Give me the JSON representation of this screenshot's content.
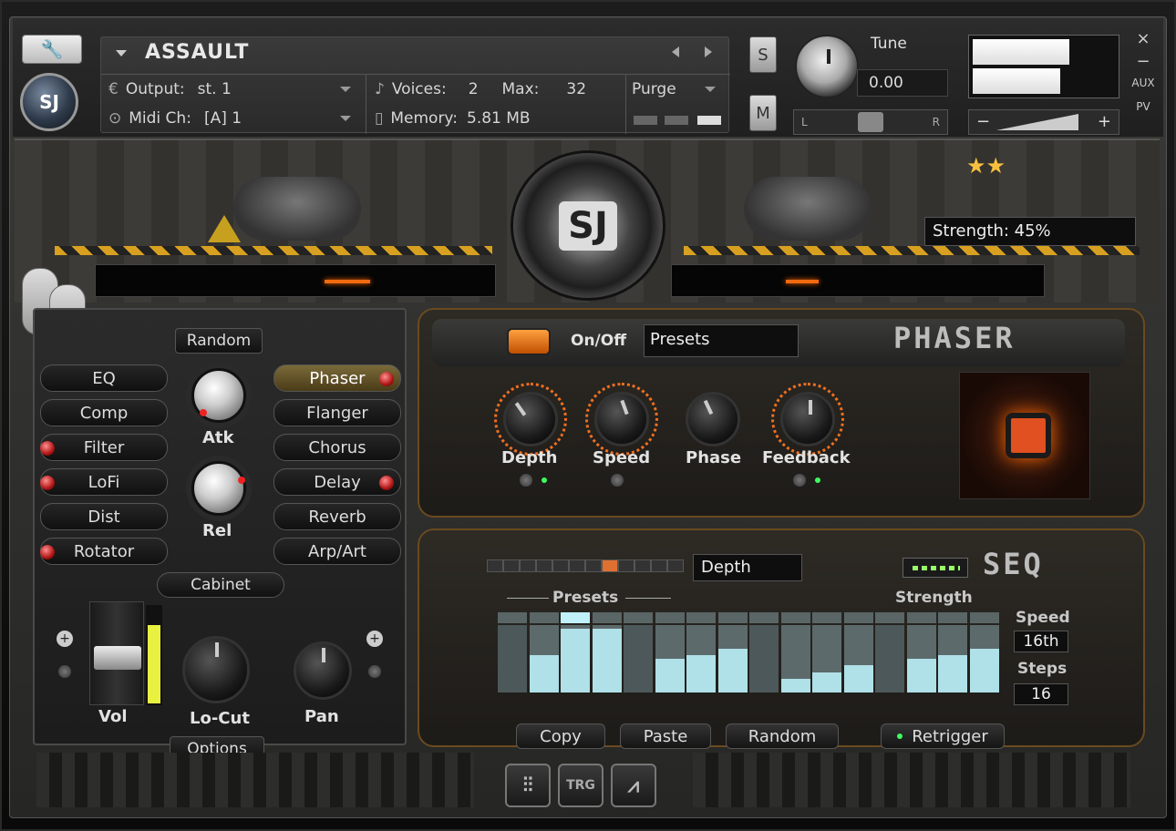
{
  "header": {
    "instrument_name": "ASSAULT",
    "output_label": "Output:",
    "output_value": "st. 1",
    "midi_label": "Midi Ch:",
    "midi_value": "[A] 1",
    "voices_label": "Voices:",
    "voices_value": "2",
    "max_label": "Max:",
    "max_value": "32",
    "memory_label": "Memory:",
    "memory_value": "5.81 MB",
    "purge_label": "Purge",
    "solo_label": "S",
    "mute_label": "M",
    "tune_label": "Tune",
    "tune_value": "0.00",
    "pan_left": "L",
    "pan_right": "R",
    "vol_minus": "−",
    "vol_plus": "+",
    "close": "×",
    "minimize": "−",
    "aux": "AUX",
    "pv": "PV"
  },
  "main": {
    "logo_text": "SJ",
    "strength_text": "Strength: 45%",
    "stars": "★★"
  },
  "left_panel": {
    "random_label": "Random",
    "fx_left": [
      "EQ",
      "Comp",
      "Filter",
      "LoFi",
      "Dist",
      "Rotator"
    ],
    "fx_right": [
      "Phaser",
      "Flanger",
      "Chorus",
      "Delay",
      "Reverb",
      "Arp/Art"
    ],
    "atk_label": "Atk",
    "rel_label": "Rel",
    "cabinet_label": "Cabinet",
    "vol_label": "Vol",
    "locut_label": "Lo-Cut",
    "pan_label": "Pan",
    "options_label": "Options"
  },
  "phaser": {
    "onoff_label": "On/Off",
    "presets_label": "Presets",
    "title": "PHASER",
    "knobs": [
      "Depth",
      "Speed",
      "Phase",
      "Feedback"
    ]
  },
  "seq": {
    "title": "SEQ",
    "target": "Depth",
    "presets_label": "Presets",
    "strength_label": "Strength",
    "speed_label": "Speed",
    "speed_value": "16th",
    "steps_label": "Steps",
    "steps_value": "16",
    "active_step": 3,
    "step_values": [
      0.0,
      0.55,
      0.95,
      0.95,
      0.0,
      0.5,
      0.55,
      0.65,
      0.0,
      0.2,
      0.3,
      0.4,
      0.0,
      0.5,
      0.55,
      0.65
    ],
    "buttons": [
      "Copy",
      "Paste",
      "Random",
      "Retrigger"
    ]
  },
  "tabs": [
    "mixer",
    "TRG",
    "graph"
  ],
  "colors": {
    "accent_orange": "#f07020",
    "step_bar": "#b0e0e8",
    "led_red": "#d02020",
    "meter_yellow": "#e8f040"
  }
}
